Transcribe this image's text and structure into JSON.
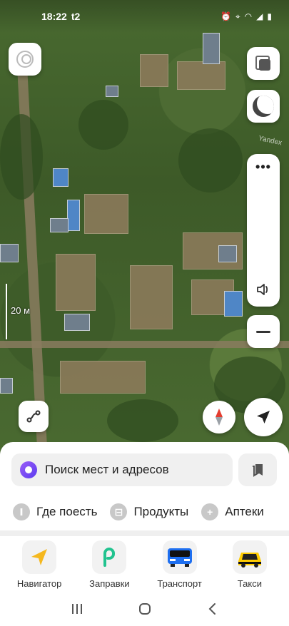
{
  "status_bar": {
    "time": "18:22",
    "carrier_badge": "t2",
    "battery": "▮"
  },
  "map": {
    "scale_label": "20 м",
    "watermark": "Yandex"
  },
  "controls": {
    "zoom_dots": "•••"
  },
  "search": {
    "placeholder": "Поиск мест и адресов"
  },
  "quick_actions": [
    {
      "label": "Где поесть",
      "icon": "fork-knife-icon"
    },
    {
      "label": "Продукты",
      "icon": "basket-icon"
    },
    {
      "label": "Аптеки",
      "icon": "pharmacy-cross-icon"
    }
  ],
  "services": [
    {
      "label": "Навигатор",
      "icon": "navigator-arrow-icon"
    },
    {
      "label": "Заправки",
      "icon": "fuel-icon"
    },
    {
      "label": "Транспорт",
      "icon": "bus-icon"
    },
    {
      "label": "Такси",
      "icon": "taxi-icon"
    }
  ],
  "colors": {
    "navigator": "#f5b81e",
    "fuel": "#21c38f",
    "bus": "#1e6ff0",
    "taxi": "#ffcc00"
  }
}
